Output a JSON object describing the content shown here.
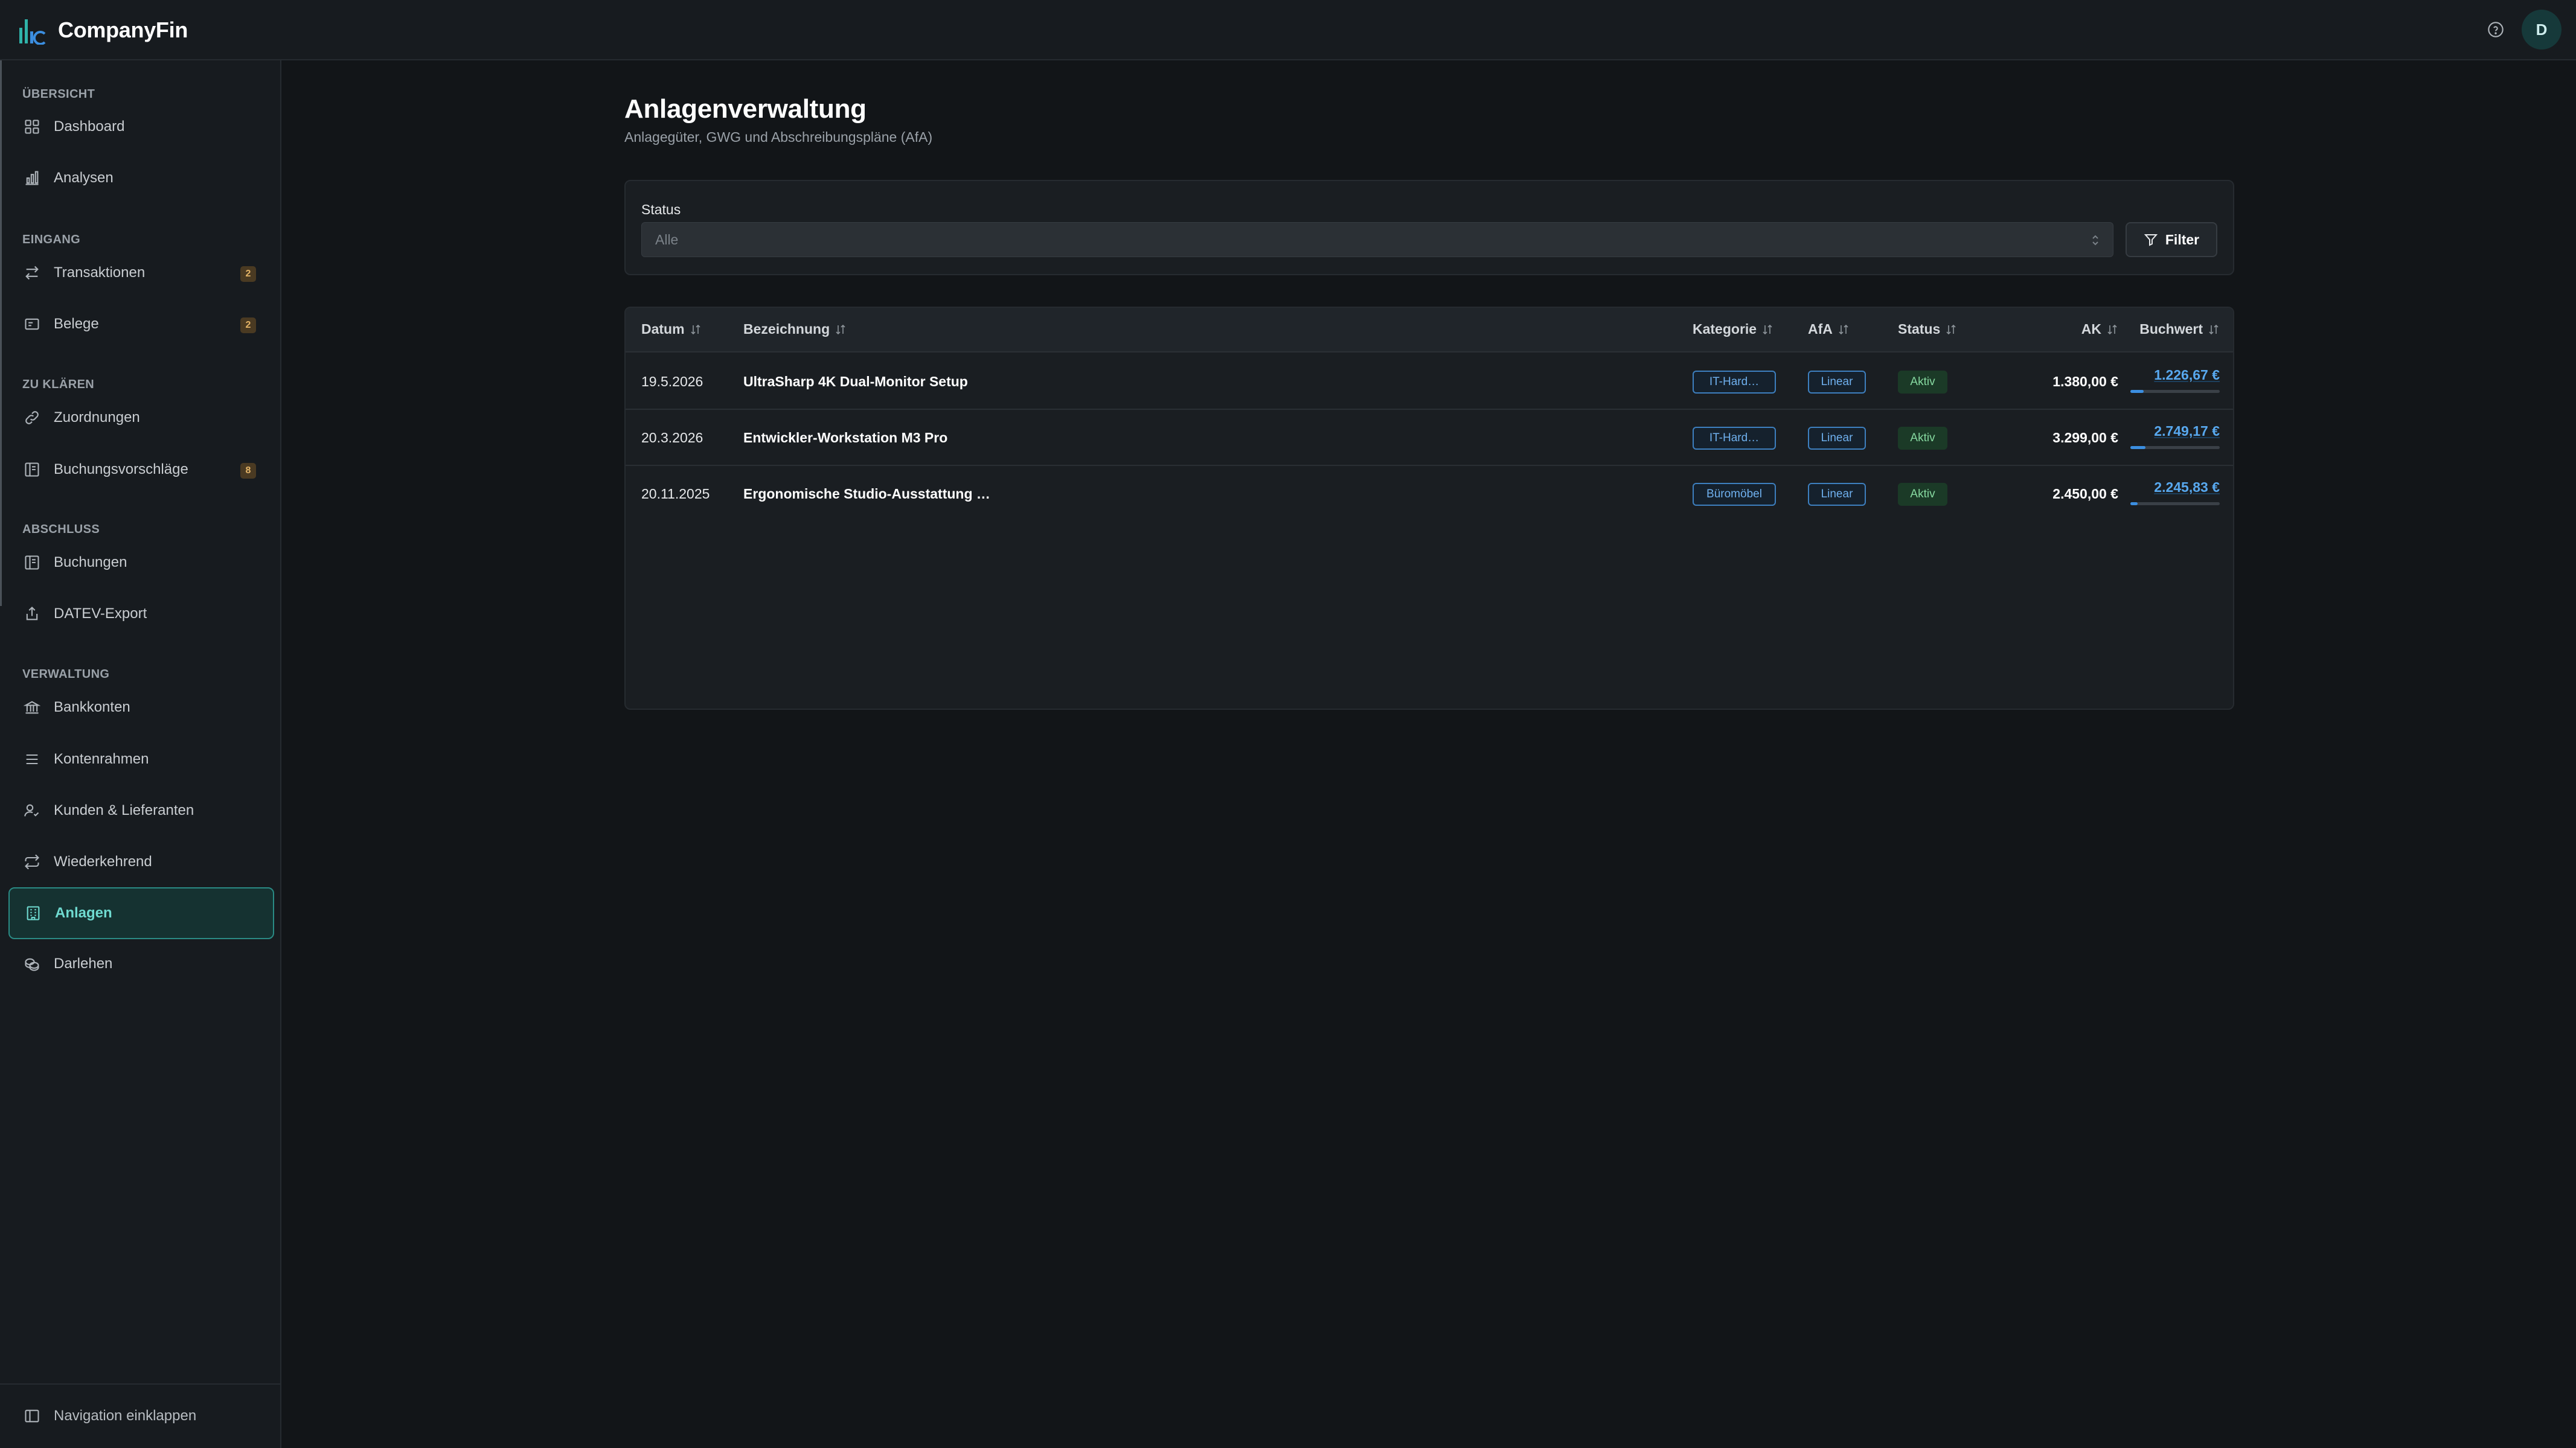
{
  "app": {
    "name": "CompanyFin",
    "user_initial": "D"
  },
  "colors": {
    "accent": "#2a8a84",
    "accent_text": "#6fdad0",
    "link": "#58a8ee",
    "badge": "#e4b467",
    "status_active": "#86d9a0"
  },
  "sidebar": {
    "sections": [
      {
        "title": "ÜBERSICHT",
        "items": [
          {
            "label": "Dashboard",
            "icon": "grid-icon"
          },
          {
            "label": "Analysen",
            "icon": "bar-chart-icon"
          }
        ]
      },
      {
        "title": "EINGANG",
        "items": [
          {
            "label": "Transaktionen",
            "icon": "arrows-swap-icon",
            "badge": "2"
          },
          {
            "label": "Belege",
            "icon": "receipt-icon",
            "badge": "2"
          }
        ]
      },
      {
        "title": "ZU KLÄREN",
        "items": [
          {
            "label": "Zuordnungen",
            "icon": "link-icon"
          },
          {
            "label": "Buchungsvorschläge",
            "icon": "ledger-icon",
            "badge": "8"
          }
        ]
      },
      {
        "title": "ABSCHLUSS",
        "items": [
          {
            "label": "Buchungen",
            "icon": "ledger-icon"
          },
          {
            "label": "DATEV-Export",
            "icon": "export-icon"
          }
        ]
      },
      {
        "title": "VERWALTUNG",
        "items": [
          {
            "label": "Bankkonten",
            "icon": "bank-icon"
          },
          {
            "label": "Kontenrahmen",
            "icon": "list-icon"
          },
          {
            "label": "Kunden & Lieferanten",
            "icon": "user-check-icon"
          },
          {
            "label": "Wiederkehrend",
            "icon": "repeat-icon"
          },
          {
            "label": "Anlagen",
            "icon": "building-icon",
            "active": true
          },
          {
            "label": "Darlehen",
            "icon": "coins-icon"
          }
        ]
      }
    ],
    "collapse_label": "Navigation einklappen"
  },
  "main": {
    "title": "Anlagenverwaltung",
    "subtitle": "Anlagegüter, GWG und Abschreibungspläne (AfA)",
    "filter": {
      "status_label": "Status",
      "status_value": "Alle",
      "button_label": "Filter"
    },
    "table": {
      "columns": [
        "Datum",
        "Bezeichnung",
        "Kategorie",
        "AfA",
        "Status",
        "AK",
        "Buchwert"
      ],
      "rows": [
        {
          "date": "19.5.2026",
          "name": "UltraSharp 4K Dual-Monitor Setup",
          "category": "IT-Hard…",
          "afa": "Linear",
          "status": "Aktiv",
          "ak": "1.380,00 €",
          "book_value": "1.226,67 €",
          "book_value_ratio": 0.15
        },
        {
          "date": "20.3.2026",
          "name": "Entwickler-Workstation M3 Pro",
          "category": "IT-Hard…",
          "afa": "Linear",
          "status": "Aktiv",
          "ak": "3.299,00 €",
          "book_value": "2.749,17 €",
          "book_value_ratio": 0.17
        },
        {
          "date": "20.11.2025",
          "name": "Ergonomische Studio-Ausstattung …",
          "category": "Büromöbel",
          "afa": "Linear",
          "status": "Aktiv",
          "ak": "2.450,00 €",
          "book_value": "2.245,83 €",
          "book_value_ratio": 0.08
        }
      ]
    }
  }
}
